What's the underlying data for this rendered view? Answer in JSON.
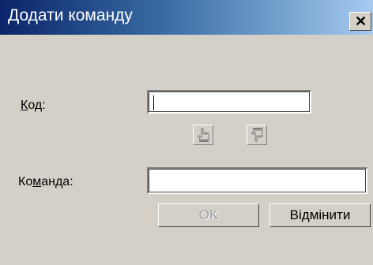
{
  "window": {
    "title": "Додати команду",
    "close_glyph": "×"
  },
  "form": {
    "code_label_prefix": "",
    "code_label_accel": "К",
    "code_label_rest": "од:",
    "code_value": "",
    "command_label_prefix": "Ко",
    "command_label_accel": "м",
    "command_label_rest": "анда:",
    "command_value": ""
  },
  "icons": {
    "up": "pointing-up-hand-icon",
    "down": "pointing-down-hand-icon"
  },
  "buttons": {
    "ok_label": "OK",
    "cancel_label": "Відмінити"
  }
}
